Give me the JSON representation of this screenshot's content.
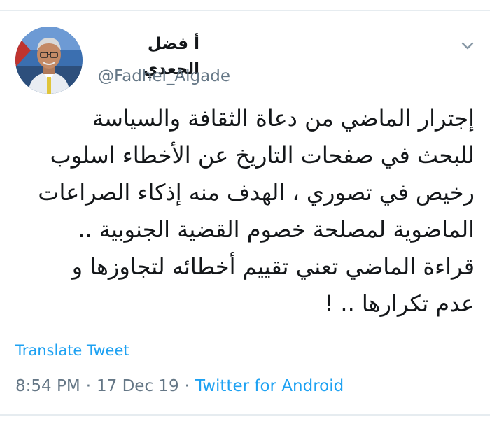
{
  "tweet": {
    "author": {
      "display_name": "أ فضل الجعدي",
      "handle": "@Fadhel_Algade",
      "avatar_icon": "profile-photo"
    },
    "menu_icon": "chevron-down-icon",
    "text": "إجترار الماضي من دعاة الثقافة والسياسة\nللبحث في صفحات التاريخ عن الأخطاء اسلوب\nرخيص في تصوري ، الهدف منه إذكاء الصراعات\nالماضوية لمصلحة خصوم القضية الجنوبية ..\nقراءة الماضي تعني تقييم أخطائه لتجاوزها و\nعدم تكرارها .. !",
    "translate_label": "Translate Tweet",
    "time": "8:54 PM",
    "separator": "·",
    "date": "17 Dec 19",
    "source": "Twitter for Android"
  },
  "colors": {
    "link": "#1da1f2",
    "secondary_text": "#657786",
    "primary_text": "#14171a",
    "divider": "#e6ecf0"
  }
}
